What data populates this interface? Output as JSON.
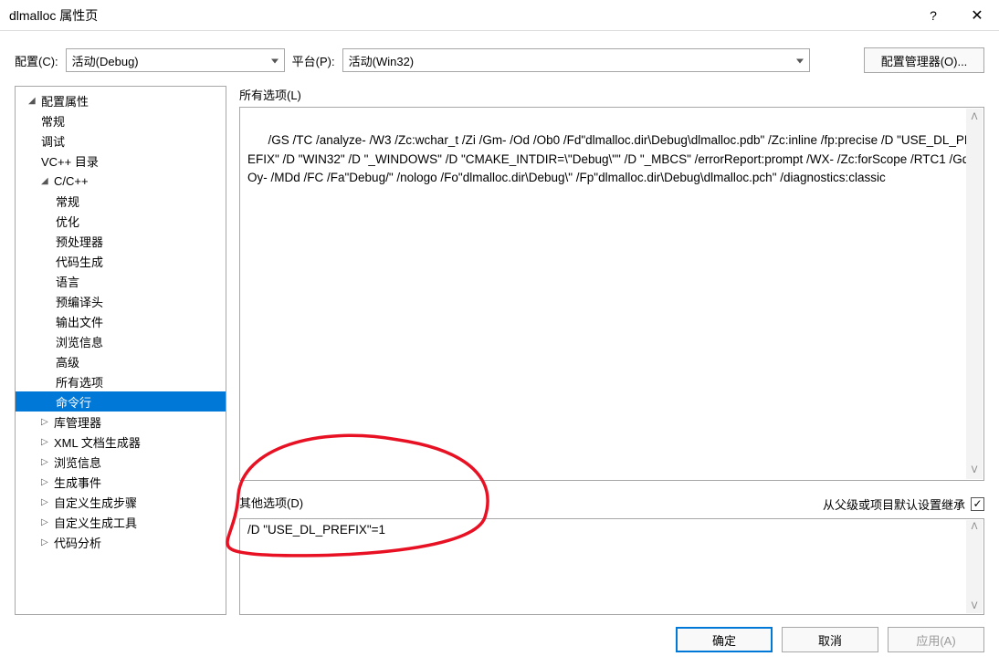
{
  "title": "dlmalloc 属性页",
  "titlebar": {
    "help": "?",
    "close": "✕"
  },
  "topbar": {
    "config_label": "配置(C):",
    "config_value": "活动(Debug)",
    "platform_label": "平台(P):",
    "platform_value": "活动(Win32)",
    "cfgmgr_label": "配置管理器(O)..."
  },
  "tree": {
    "root": "配置属性",
    "general": "常规",
    "debug": "调试",
    "vcdirs": "VC++ 目录",
    "cpp": "C/C++",
    "cpp_items": {
      "general": "常规",
      "opt": "优化",
      "preproc": "预处理器",
      "codegen": "代码生成",
      "lang": "语言",
      "pch": "预编译头",
      "output": "输出文件",
      "browse": "浏览信息",
      "adv": "高级",
      "all": "所有选项",
      "cmdline": "命令行"
    },
    "librarian": "库管理器",
    "xmldoc": "XML 文档生成器",
    "browseinfo": "浏览信息",
    "buildevents": "生成事件",
    "custombuild": "自定义生成步骤",
    "customtool": "自定义生成工具",
    "codeanalysis": "代码分析"
  },
  "right": {
    "allopts_label": "所有选项(L)",
    "allopts_text": "/GS /TC /analyze- /W3 /Zc:wchar_t /Zi /Gm- /Od /Ob0 /Fd\"dlmalloc.dir\\Debug\\dlmalloc.pdb\" /Zc:inline /fp:precise /D \"USE_DL_PREFIX\" /D \"WIN32\" /D \"_WINDOWS\" /D \"CMAKE_INTDIR=\\\"Debug\\\"\" /D \"_MBCS\" /errorReport:prompt /WX- /Zc:forScope /RTC1 /Gd /Oy- /MDd /FC /Fa\"Debug/\" /nologo /Fo\"dlmalloc.dir\\Debug\\\" /Fp\"dlmalloc.dir\\Debug\\dlmalloc.pch\" /diagnostics:classic",
    "otheropts_label": "其他选项(D)",
    "inherit_label": "从父级或项目默认设置继承",
    "otheropts_text": "/D \"USE_DL_PREFIX\"=1"
  },
  "footer": {
    "ok": "确定",
    "cancel": "取消",
    "apply": "应用(A)"
  }
}
